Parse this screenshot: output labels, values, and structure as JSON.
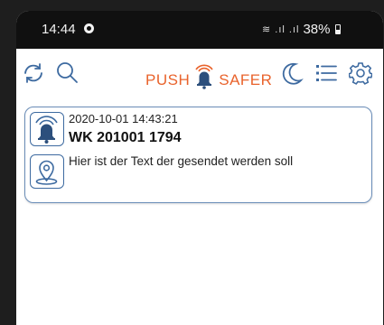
{
  "statusbar": {
    "time": "14:44",
    "signal_icons": "≋ .ıl .ıl",
    "battery": "38%"
  },
  "toolbar": {
    "logo_left": "PUSH",
    "logo_right": "SAFER",
    "icons": [
      "refresh-icon",
      "search-icon",
      "night-mode-icon",
      "list-icon",
      "settings-icon"
    ]
  },
  "messages": [
    {
      "date": "2020-10-01 14:43:21",
      "title": "WK 201001 1794",
      "text": "Hier ist der Text der gesendet werden soll"
    }
  ],
  "colors": {
    "accent": "#e9632c",
    "icon_blue": "#3d6aa0",
    "card_border": "#6a8db8"
  }
}
